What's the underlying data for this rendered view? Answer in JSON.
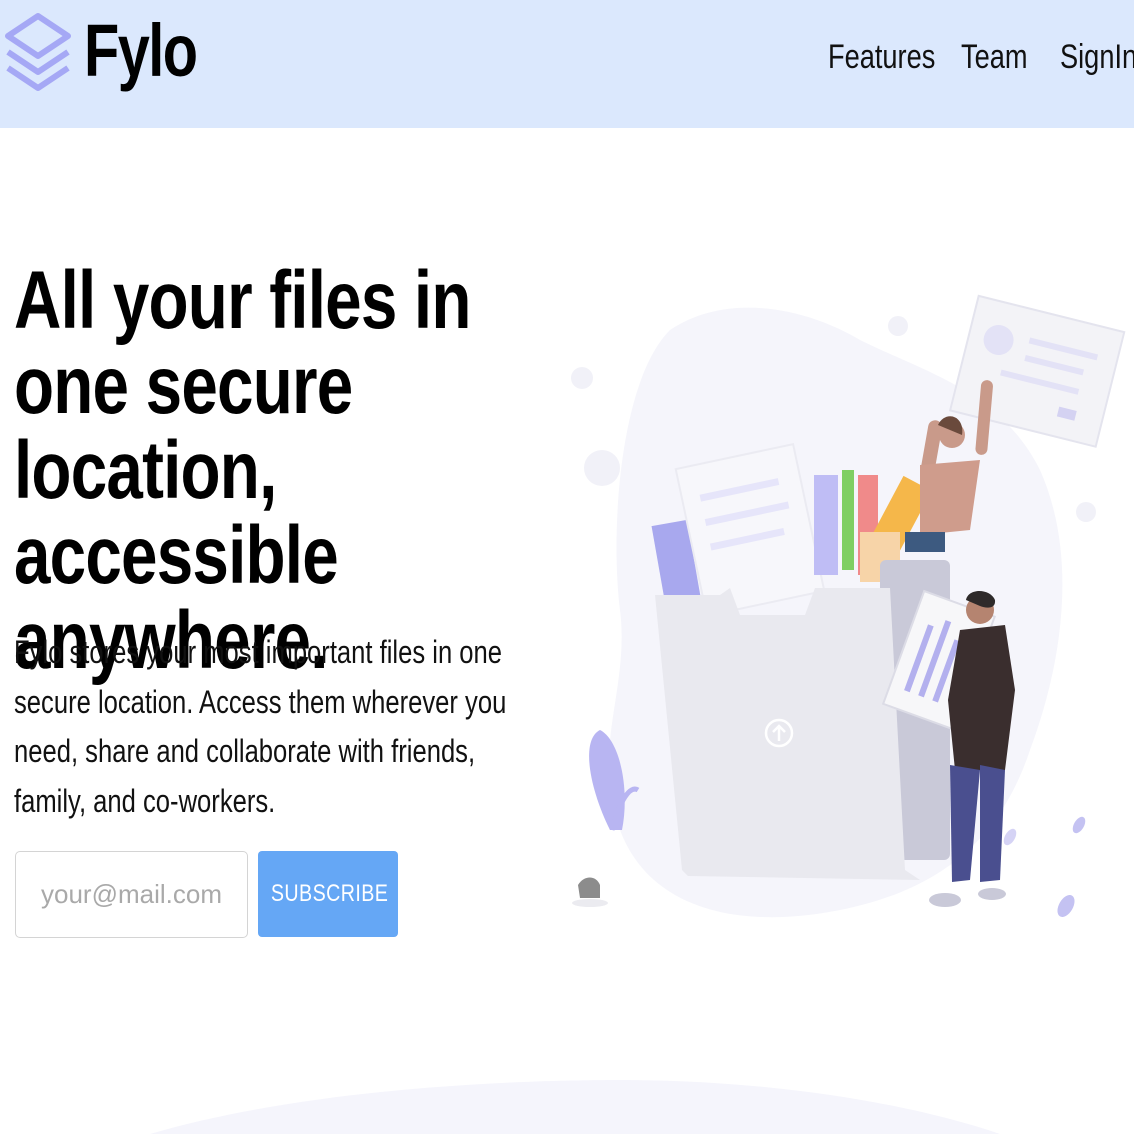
{
  "header": {
    "brand": "Fylo",
    "nav": [
      {
        "label": "Features"
      },
      {
        "label": "Team"
      },
      {
        "label": "SignIn"
      }
    ]
  },
  "hero": {
    "title": "All your files in one secure location, accessible anywhere.",
    "description": "Fylo stores your most important files in one secure location. Access them wherever you need, share and collaborate with friends, family, and co-workers.",
    "email_placeholder": "your@mail.com",
    "email_value": "",
    "subscribe_label": "SUBSCRIBE"
  },
  "colors": {
    "header_bg": "#dbe8fd",
    "accent": "#65a7f5",
    "logo": "#a5a8f5"
  },
  "icons": [
    "layers-logo-icon",
    "upload-arrow-icon"
  ]
}
